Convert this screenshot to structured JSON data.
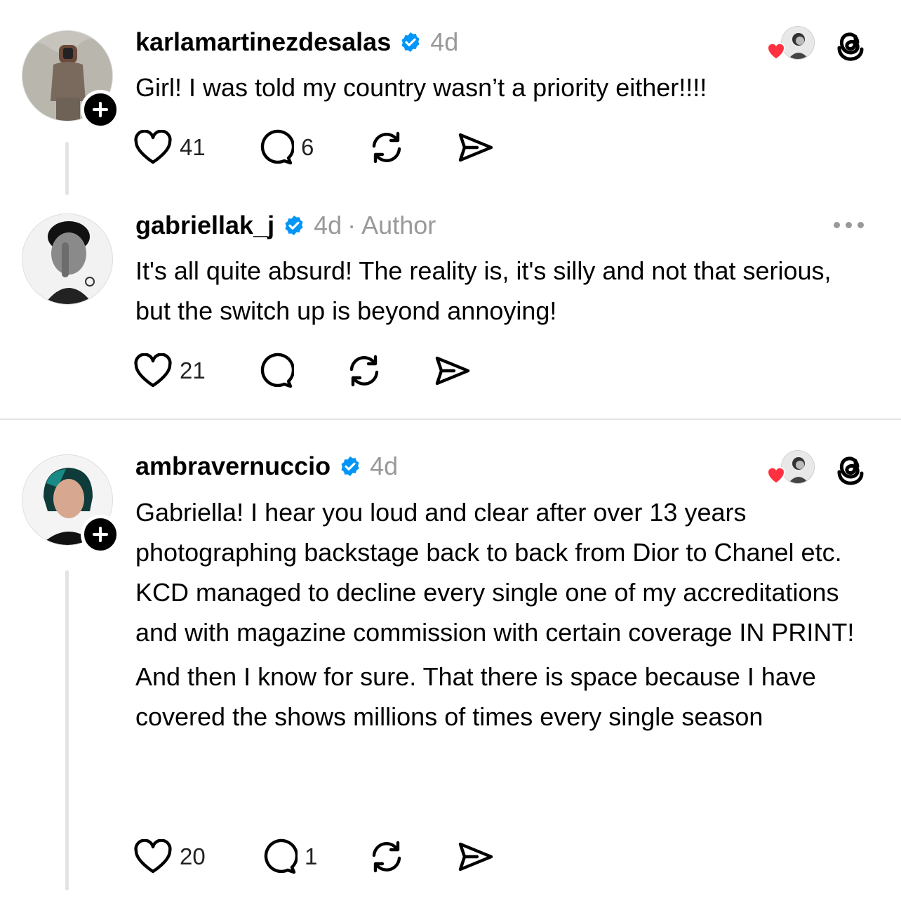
{
  "posts": [
    {
      "username": "karlamartinezdesalas",
      "verified": true,
      "time": "4d",
      "text": [
        "Girl! I was told my country wasn’t a priority either!!!!"
      ],
      "likes": "41",
      "replies": "6"
    },
    {
      "username": "gabriellak_j",
      "verified": true,
      "time": "4d",
      "separator": "·",
      "author_label": "Author",
      "text": [
        "It's all quite absurd! The reality is, it's silly and not that serious, but the switch up is beyond annoying!"
      ],
      "likes": "21",
      "replies": ""
    },
    {
      "username": "ambravernuccio",
      "verified": true,
      "time": "4d",
      "text": [
        "Gabriella! I hear you loud and clear after over 13 years photographing backstage back to back from Dior to Chanel etc. KCD managed to decline every single one of my accreditations and with magazine commission with certain coverage IN PRINT!",
        "And then I know for sure. That there is space because I have covered the shows millions of times every single season"
      ],
      "likes": "20",
      "replies": "1"
    }
  ],
  "icons": {
    "verified": "verified-badge-icon",
    "like": "heart-icon",
    "reply": "comment-bubble-icon",
    "repost": "repost-icon",
    "share": "send-icon",
    "threads": "threads-logo-icon",
    "more": "more-dots-icon",
    "follow": "plus-icon"
  },
  "colors": {
    "verified": "#0095f6",
    "heart": "#ff3040",
    "muted": "#999999",
    "text": "#000000"
  }
}
